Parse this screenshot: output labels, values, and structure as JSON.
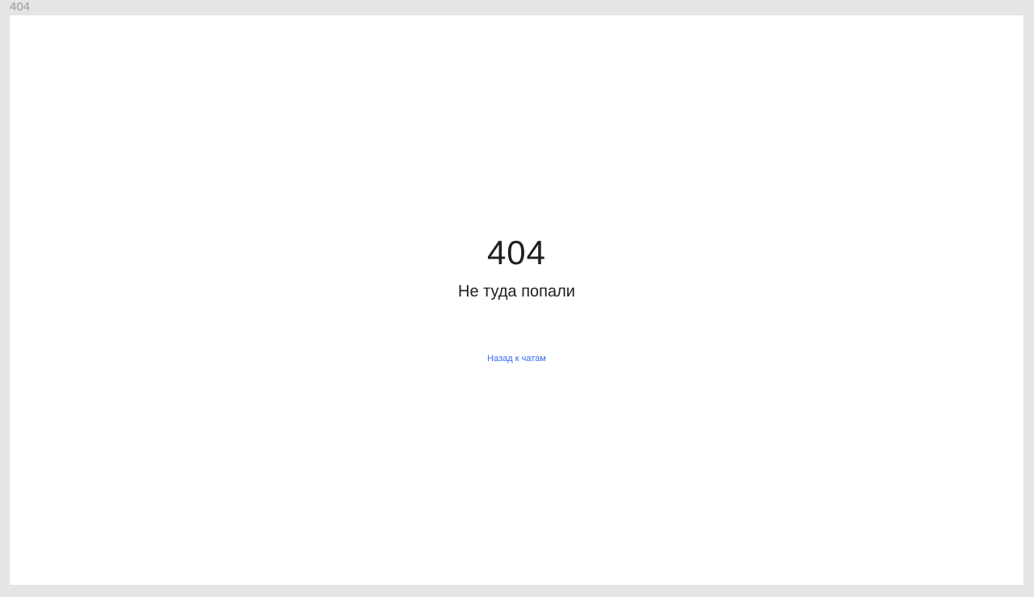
{
  "frame": {
    "label": "404"
  },
  "error": {
    "code": "404",
    "message": "Не туда попали",
    "back_link": "Назад к чатам"
  },
  "colors": {
    "background": "#e5e5e5",
    "card": "#ffffff",
    "text": "#1e1e1e",
    "link": "#3369f3",
    "frame_label": "#9a9a9a"
  }
}
